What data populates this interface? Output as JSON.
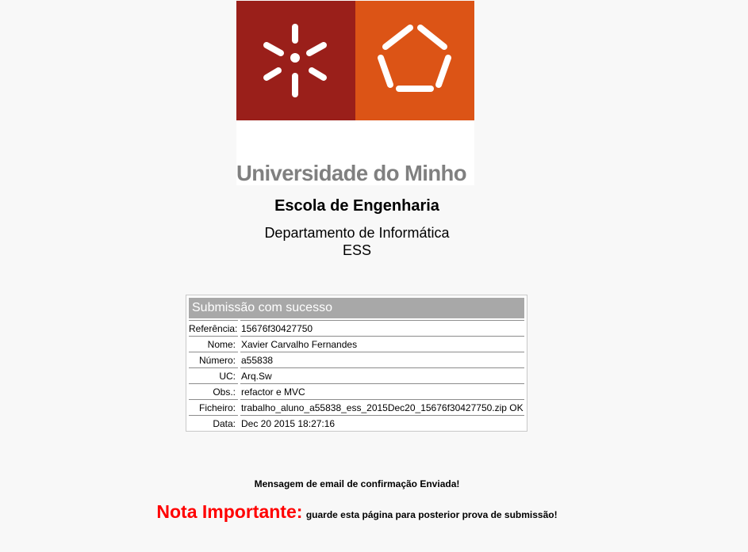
{
  "university": {
    "name": "Universidade do Minho",
    "school": "Escola de Engenharia",
    "department": "Departamento de Informática",
    "course": "ESS"
  },
  "colors": {
    "logo_red": "#9a1f1a",
    "logo_orange": "#dc5416",
    "logo_text": "#808080",
    "header_bg": "#a8a8a8",
    "note_red": "#ff0000"
  },
  "submission": {
    "title": "Submissão com sucesso",
    "rows": [
      {
        "label": "Referência:",
        "value": "15676f30427750"
      },
      {
        "label": "Nome:",
        "value": "Xavier Carvalho Fernandes"
      },
      {
        "label": "Número:",
        "value": "a55838"
      },
      {
        "label": "UC:",
        "value": "Arq.Sw"
      },
      {
        "label": "Obs.:",
        "value": "refactor e MVC"
      },
      {
        "label": "Ficheiro:",
        "value": "trabalho_aluno_a55838_ess_2015Dec20_15676f30427750.zip OK"
      },
      {
        "label": "Data:",
        "value": "Dec 20 2015 18:27:16"
      }
    ]
  },
  "messages": {
    "email_sent": "Mensagem de email de confirmação Enviada!",
    "note_title": "Nota Importante:",
    "note_text": "guarde esta página para posterior prova de submissão!"
  }
}
